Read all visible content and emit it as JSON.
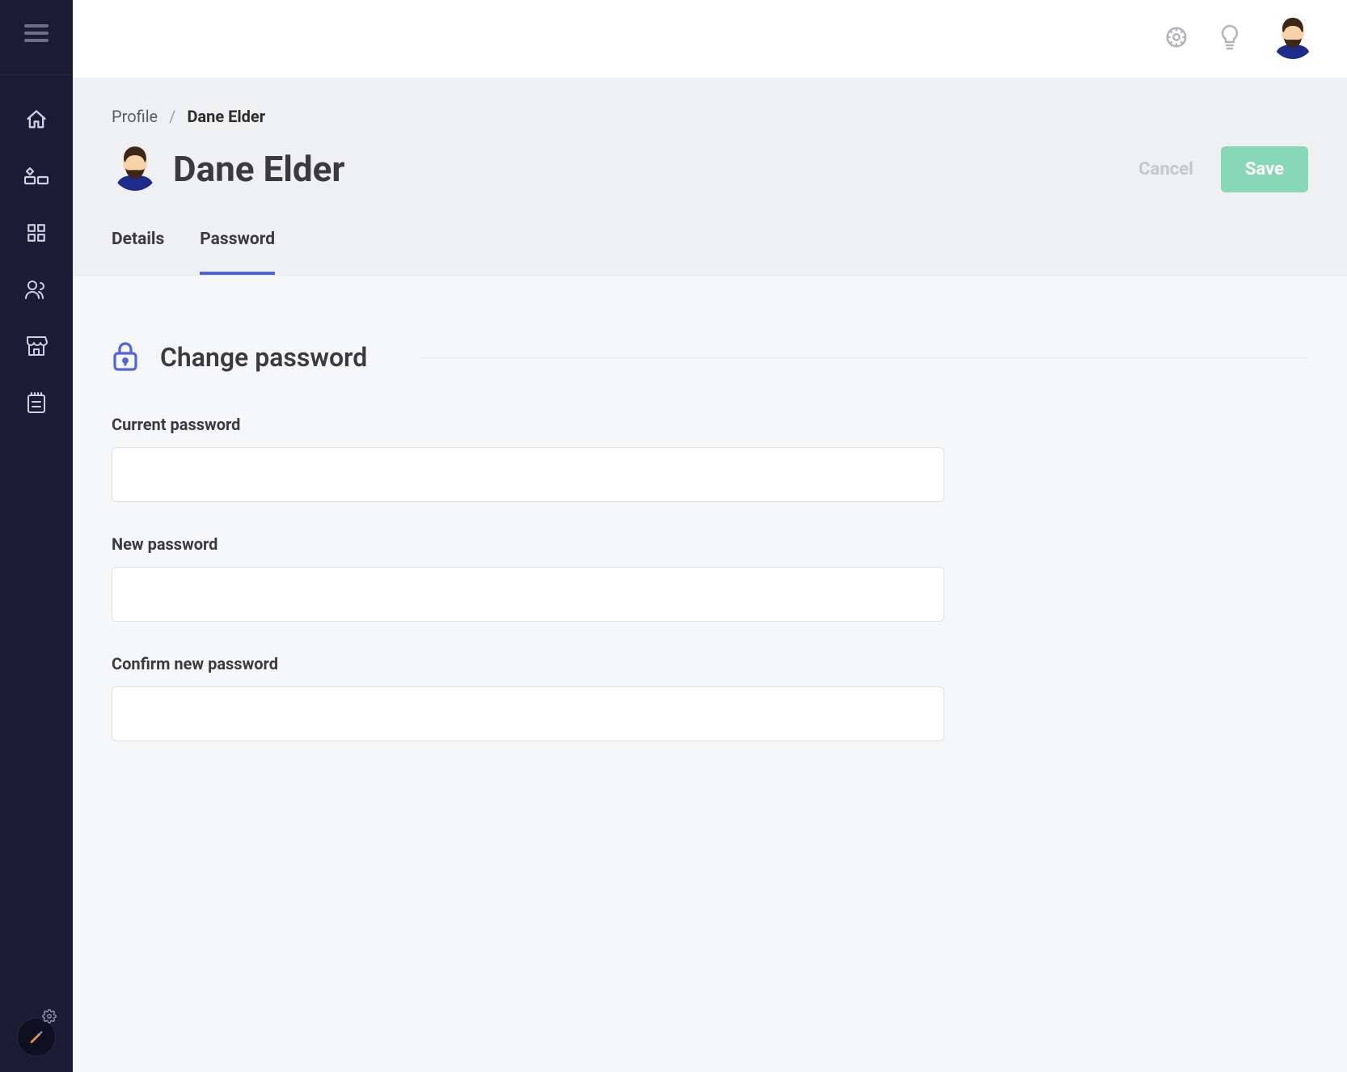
{
  "breadcrumb": {
    "root": "Profile",
    "current": "Dane Elder"
  },
  "page": {
    "title": "Dane Elder"
  },
  "actions": {
    "cancel": "Cancel",
    "save": "Save"
  },
  "tabs": {
    "details": "Details",
    "password": "Password"
  },
  "section": {
    "heading": "Change password"
  },
  "fields": {
    "current_password": {
      "label": "Current password",
      "value": ""
    },
    "new_password": {
      "label": "New password",
      "value": ""
    },
    "confirm_password": {
      "label": "Confirm new password",
      "value": ""
    }
  },
  "sidebar_icons": {
    "menu": "menu",
    "home": "home",
    "blocks": "blocks",
    "grid": "grid",
    "people": "people",
    "store": "store",
    "clipboard": "clipboard"
  },
  "topbar_icons": {
    "settings": "settings",
    "idea": "lightbulb"
  },
  "colors": {
    "sidebar_bg": "#1b1b33",
    "accent": "#5264dc",
    "save_bg": "#87d8b7",
    "header_bg": "#eff0f2",
    "content_bg": "#f6f7f8"
  }
}
